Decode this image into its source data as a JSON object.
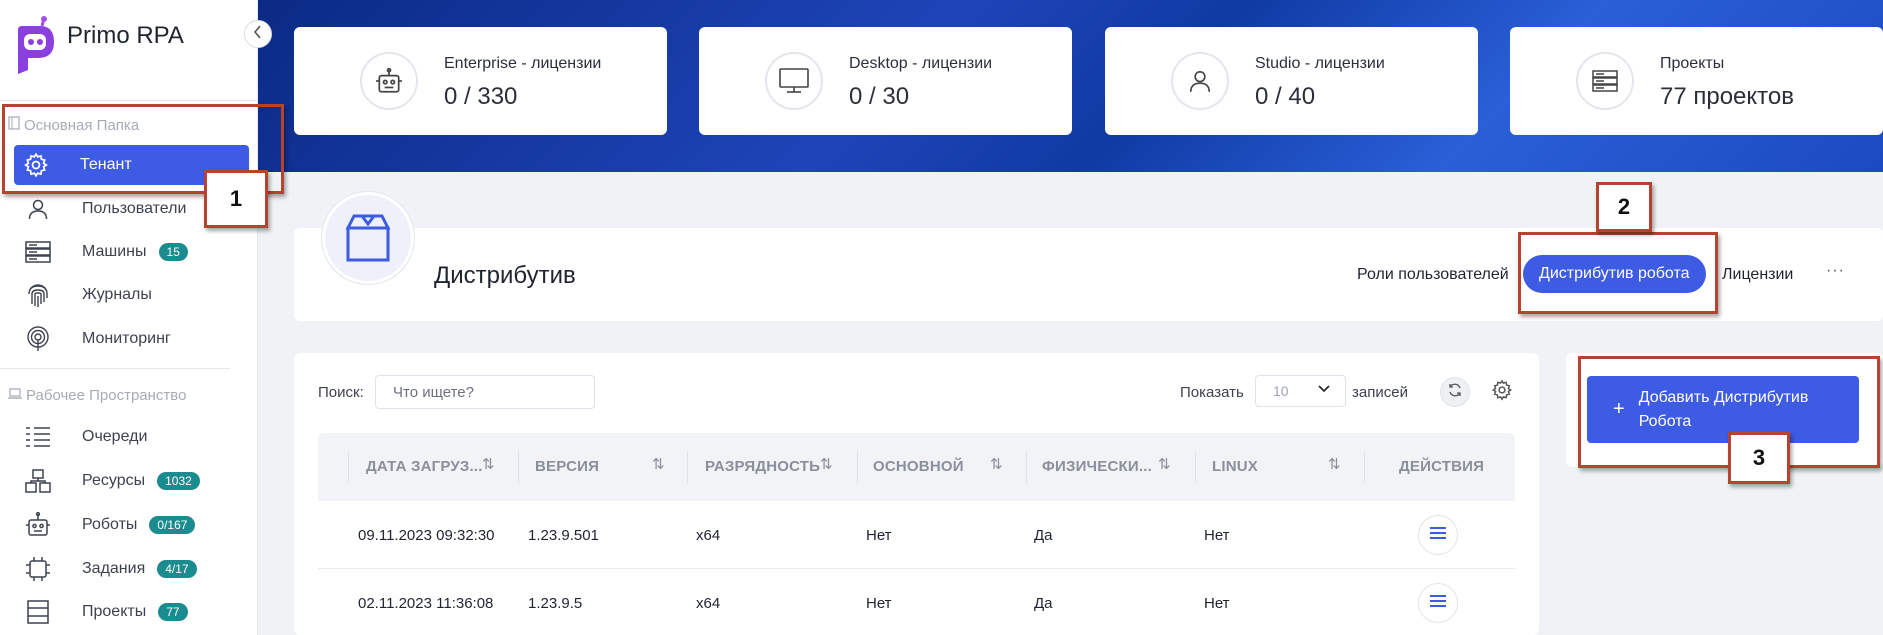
{
  "app": {
    "title": "Primo RPA"
  },
  "sidebar": {
    "section_main": "Основная Папка",
    "section_workspace": "Рабочее Пространство",
    "items": [
      {
        "label": "Тенант",
        "icon": "gear-icon",
        "active": true
      },
      {
        "label": "Пользователи",
        "icon": "user-icon"
      },
      {
        "label": "Машины",
        "icon": "server-icon",
        "badge": "15"
      },
      {
        "label": "Журналы",
        "icon": "fingerprint-icon"
      },
      {
        "label": "Мониторинг",
        "icon": "monitoring-icon"
      },
      {
        "label": "Очереди",
        "icon": "list-icon"
      },
      {
        "label": "Ресурсы",
        "icon": "resources-icon",
        "badge": "1032"
      },
      {
        "label": "Роботы",
        "icon": "robot-icon",
        "badge": "0/167"
      },
      {
        "label": "Задания",
        "icon": "tasks-icon",
        "badge": "4/17"
      },
      {
        "label": "Проекты",
        "icon": "projects-icon",
        "badge": "77"
      }
    ]
  },
  "stats": [
    {
      "label": "Enterprise - лицензии",
      "value": "0 / 330",
      "icon": "robot-icon"
    },
    {
      "label": "Desktop - лицензии",
      "value": "0 / 30",
      "icon": "monitor-icon"
    },
    {
      "label": "Studio - лицензии",
      "value": "0 / 40",
      "icon": "user-icon"
    },
    {
      "label": "Проекты",
      "value": "77 проектов",
      "icon": "server-icon"
    }
  ],
  "page": {
    "title": "Дистрибутив",
    "tabs": [
      "Роли пользователей",
      "Дистрибутив робота",
      "Лицензии"
    ],
    "more": "···"
  },
  "table": {
    "search_label": "Поиск:",
    "search_placeholder": "Что ищете?",
    "show_label": "Показать",
    "page_size": "10",
    "records_label": "записей",
    "columns": [
      "ДАТА ЗАГРУЗ...",
      "ВЕРСИЯ",
      "РАЗРЯДНОСТЬ",
      "ОСНОВНОЙ",
      "ФИЗИЧЕСКИ...",
      "LINUX",
      "ДЕЙСТВИЯ"
    ],
    "rows": [
      {
        "date": "09.11.2023 09:32:30",
        "version": "1.23.9.501",
        "bits": "x64",
        "main": "Нет",
        "physical": "Да",
        "linux": "Нет"
      },
      {
        "date": "02.11.2023 11:36:08",
        "version": "1.23.9.5",
        "bits": "x64",
        "main": "Нет",
        "physical": "Да",
        "linux": "Нет"
      }
    ]
  },
  "add_button": {
    "label": "Добавить Дистрибутив Робота"
  },
  "callouts": [
    "1",
    "2",
    "3"
  ],
  "colors": {
    "accent": "#3e5be3",
    "badge": "#1a8b8f",
    "callout": "#b5432f"
  }
}
